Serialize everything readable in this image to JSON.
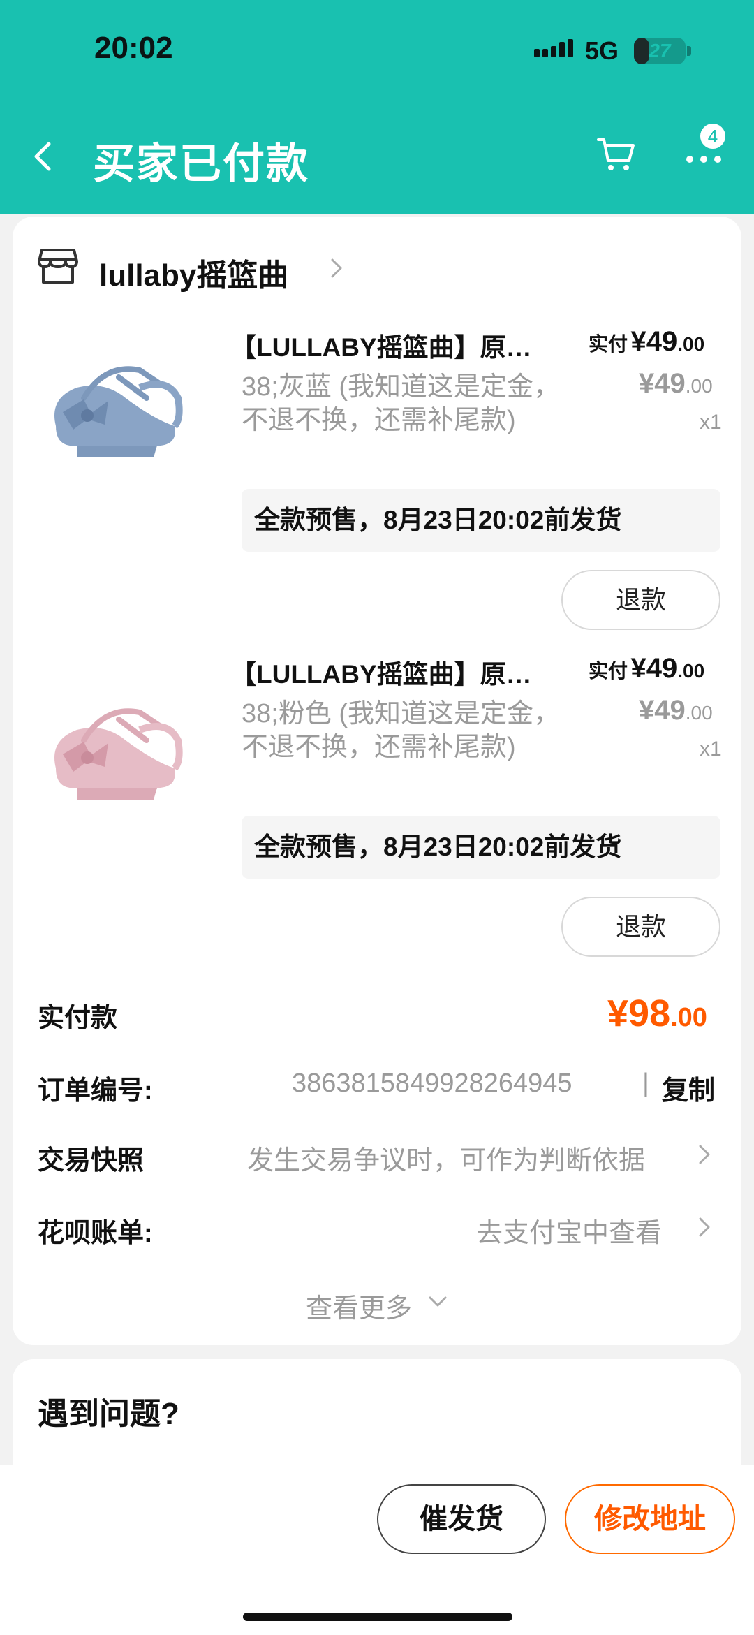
{
  "status_bar": {
    "time": "20:02",
    "network": "5G",
    "battery": "27"
  },
  "header": {
    "title": "买家已付款",
    "more_badge": "4"
  },
  "store": {
    "name": "lullaby摇篮曲"
  },
  "items": [
    {
      "title": "【LULLABY摇篮曲】原…",
      "paid_label": "实付",
      "paid_int": "¥49",
      "paid_dec": ".00",
      "sku": "38;灰蓝 (我知道这是定金，不退不换，还需补尾款)",
      "orig_int": "¥49",
      "orig_dec": ".00",
      "qty": "x1",
      "presale": "全款预售，8月23日20:02前发货",
      "refund": "退款",
      "color": "#8aa4c6"
    },
    {
      "title": "【LULLABY摇篮曲】原…",
      "paid_label": "实付",
      "paid_int": "¥49",
      "paid_dec": ".00",
      "sku": "38;粉色 (我知道这是定金，不退不换，还需补尾款)",
      "orig_int": "¥49",
      "orig_dec": ".00",
      "qty": "x1",
      "presale": "全款预售，8月23日20:02前发货",
      "refund": "退款",
      "color": "#e6bcc6"
    }
  ],
  "summary": {
    "total_label": "实付款",
    "total_int": "¥98",
    "total_dec": ".00",
    "order_no_label": "订单编号:",
    "order_no": "3863815849928264945",
    "copy": "复制",
    "snapshot_label": "交易快照",
    "snapshot_value": "发生交易争议时，可作为判断依据",
    "huabei_label": "花呗账单:",
    "huabei_value": "去支付宝中查看",
    "more": "查看更多"
  },
  "problem": {
    "title": "遇到问题?"
  },
  "actions": {
    "urge": "催发货",
    "address": "修改地址"
  }
}
